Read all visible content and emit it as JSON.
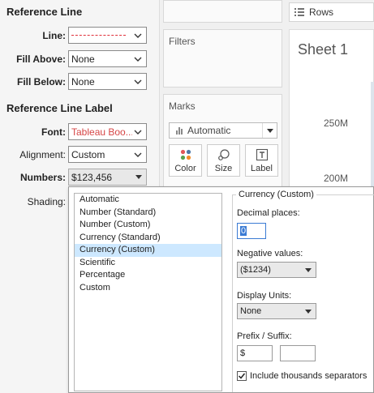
{
  "panel": {
    "reference_line_title": "Reference Line",
    "line_label": "Line:",
    "fill_above_label": "Fill Above:",
    "fill_above_value": "None",
    "fill_below_label": "Fill Below:",
    "fill_below_value": "None",
    "label_section_title": "Reference Line Label",
    "font_label": "Font:",
    "font_value": "Tableau Boo...",
    "alignment_label": "Alignment:",
    "alignment_value": "Custom",
    "numbers_label": "Numbers:",
    "numbers_value": "$123,456",
    "shading_label": "Shading:"
  },
  "middle": {
    "filters_title": "Filters",
    "marks_title": "Marks",
    "marks_type": "Automatic",
    "color_label": "Color",
    "size_label": "Size",
    "label_label": "Label"
  },
  "sheet": {
    "rows_label": "Rows",
    "title": "Sheet 1",
    "axis_ticks": [
      "250M",
      "200M"
    ]
  },
  "popup": {
    "format_options": [
      "Automatic",
      "Number (Standard)",
      "Number (Custom)",
      "Currency (Standard)",
      "Currency (Custom)",
      "Scientific",
      "Percentage",
      "Custom"
    ],
    "selected_index": 4,
    "group_title": "Currency (Custom)",
    "decimal_label": "Decimal places:",
    "decimal_value": "0",
    "negative_label": "Negative values:",
    "negative_value": "($1234)",
    "units_label": "Display Units:",
    "units_value": "None",
    "prefix_label": "Prefix / Suffix:",
    "prefix_value": "$",
    "suffix_value": "",
    "thousands_label": "Include thousands separators",
    "thousands_checked": true
  },
  "colors": {
    "selection": "#cde8ff",
    "line_sample": "#e0303a",
    "focus": "#3b7bd4"
  }
}
